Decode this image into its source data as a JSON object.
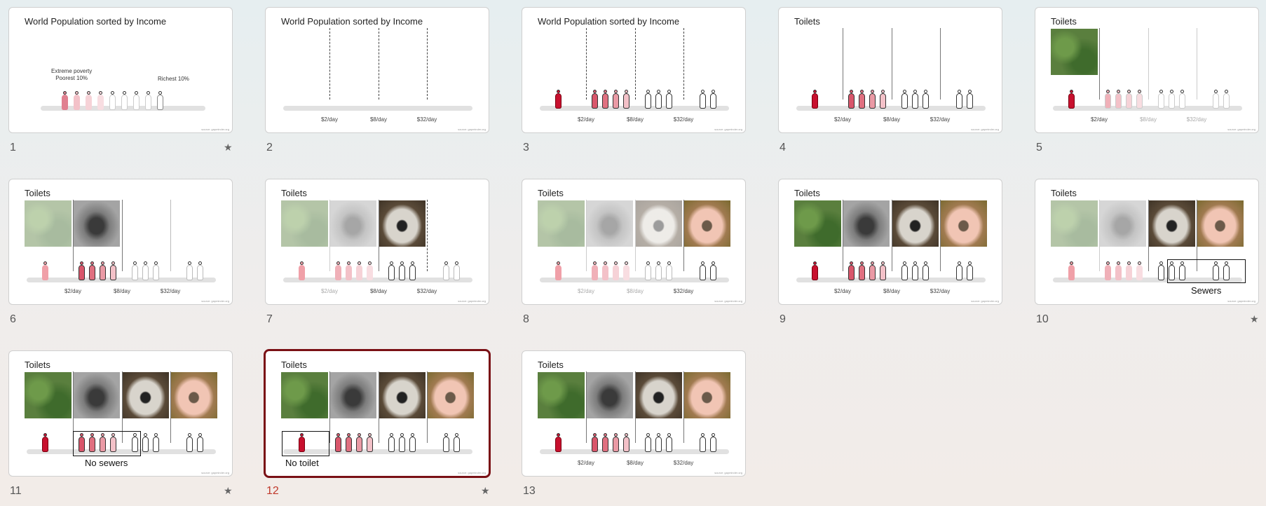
{
  "title_population": "World Population sorted by Income",
  "title_toilets": "Toilets",
  "labels": {
    "d2": "$2/day",
    "d8": "$8/day",
    "d32": "$32/day"
  },
  "slide1": {
    "extreme": "Extreme poverty",
    "poorest": "Poorest 10%",
    "richest": "Richest 10%"
  },
  "callouts": {
    "sewers": "Sewers",
    "no_sewers": "No sewers",
    "no_toilet": "No toilet"
  },
  "footer": "source: gapminder.org",
  "slides": [
    {
      "number": "1",
      "starred": true
    },
    {
      "number": "2",
      "starred": false
    },
    {
      "number": "3",
      "starred": false
    },
    {
      "number": "4",
      "starred": false
    },
    {
      "number": "5",
      "starred": false
    },
    {
      "number": "6",
      "starred": false
    },
    {
      "number": "7",
      "starred": false
    },
    {
      "number": "8",
      "starred": false
    },
    {
      "number": "9",
      "starred": false
    },
    {
      "number": "10",
      "starred": true
    },
    {
      "number": "11",
      "starred": true
    },
    {
      "number": "12",
      "starred": true,
      "selected": true
    },
    {
      "number": "13",
      "starred": false
    }
  ],
  "star_glyph": "★",
  "colors": {
    "selected_border": "#7a1015",
    "selected_number": "#c0392b"
  }
}
